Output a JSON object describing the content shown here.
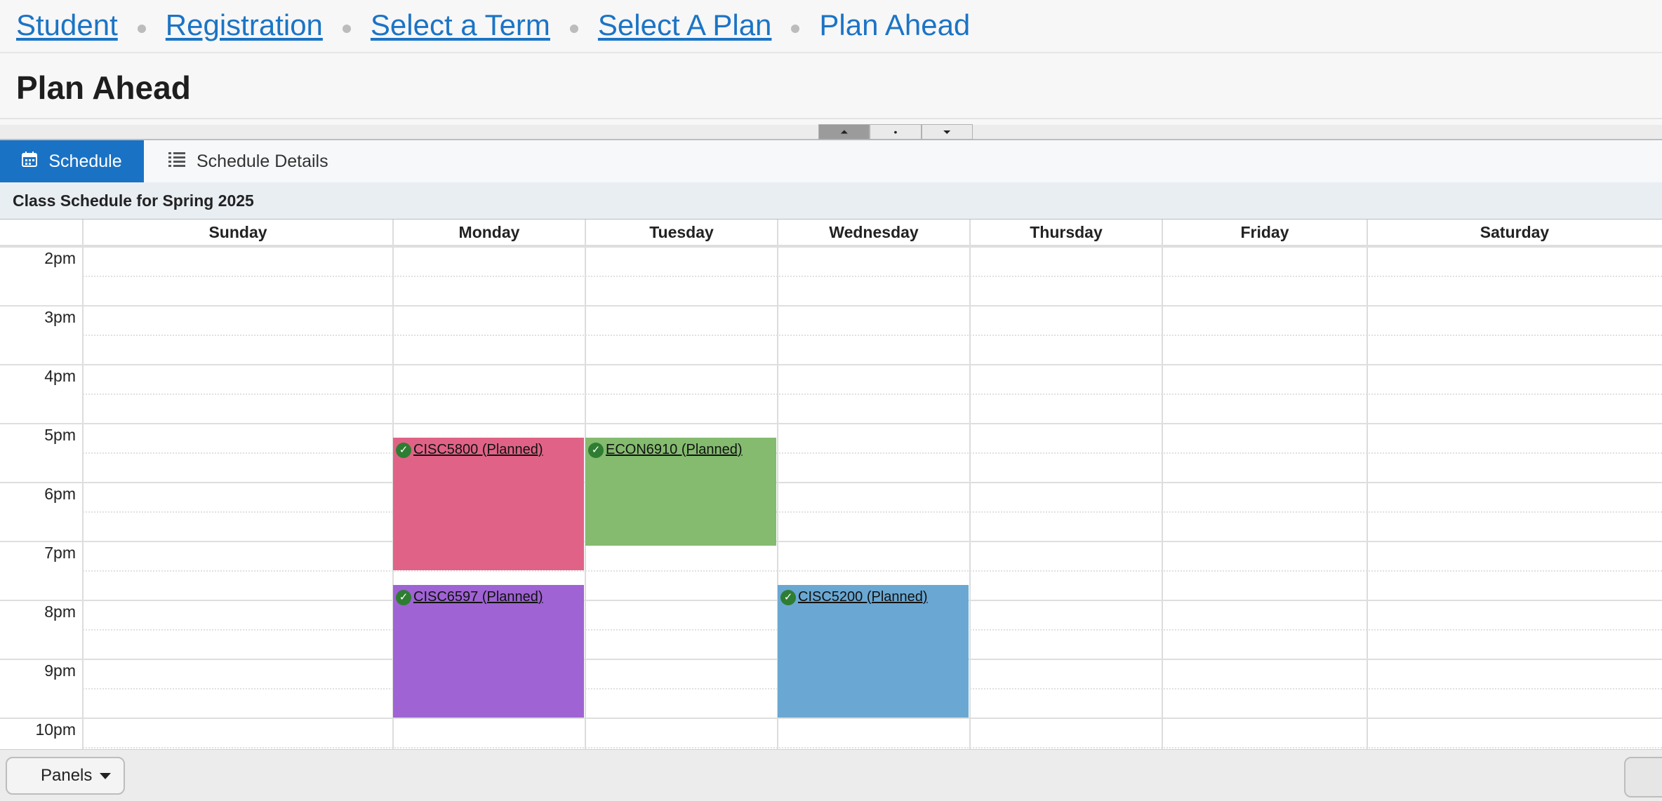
{
  "breadcrumb": {
    "items": [
      "Student",
      "Registration",
      "Select a Term",
      "Select A Plan"
    ],
    "current": "Plan Ahead"
  },
  "page_title": "Plan Ahead",
  "splitter": {
    "up": "⏶",
    "center": "•",
    "down": "⏷"
  },
  "tabs": [
    {
      "label": "Schedule",
      "icon": "calendar-icon",
      "active": true
    },
    {
      "label": "Schedule Details",
      "icon": "list-icon",
      "active": false
    }
  ],
  "schedule_header": "Class Schedule for Spring 2025",
  "days": [
    "Sunday",
    "Monday",
    "Tuesday",
    "Wednesday",
    "Thursday",
    "Friday",
    "Saturday"
  ],
  "times": [
    "2pm",
    "3pm",
    "4pm",
    "5pm",
    "6pm",
    "7pm",
    "8pm",
    "9pm",
    "10pm"
  ],
  "events": [
    {
      "label": "CISC5800 (Planned)",
      "day": "Monday",
      "start": "5:15pm",
      "end": "7:30pm",
      "color": "#e06387"
    },
    {
      "label": "ECON6910 (Planned)",
      "day": "Tuesday",
      "start": "5:15pm",
      "end": "7:05pm",
      "color": "#84bb6f"
    },
    {
      "label": "CISC6597 (Planned)",
      "day": "Monday",
      "start": "7:45pm",
      "end": "10:00pm",
      "color": "#9f63d4"
    },
    {
      "label": "CISC5200 (Planned)",
      "day": "Wednesday",
      "start": "7:45pm",
      "end": "10:00pm",
      "color": "#6aa8d3"
    }
  ],
  "footer": {
    "panels_label": "Panels"
  }
}
